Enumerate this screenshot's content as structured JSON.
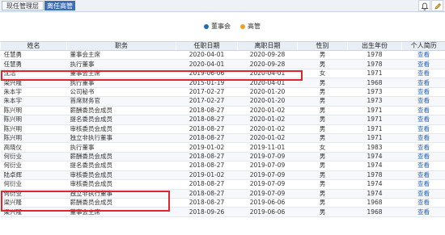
{
  "tabs": [
    {
      "label": "现任管理层"
    },
    {
      "label": "离任高管"
    }
  ],
  "toolbar": {
    "icons": [
      "bell-icon",
      "edit-icon"
    ]
  },
  "legend": [
    {
      "label": "董事会",
      "color": "#1f6db3"
    },
    {
      "label": "高管",
      "color": "#f0a11b"
    }
  ],
  "table": {
    "headers": [
      "姓名",
      "职务",
      "任职日期",
      "离职日期",
      "性别",
      "出生年份",
      "个人简历"
    ],
    "rows": [
      [
        "任慧勇",
        "董事会主席",
        "2020-04-01",
        "2020-09-28",
        "男",
        "1978",
        "查看"
      ],
      [
        "任慧勇",
        "执行董事",
        "2020-04-01",
        "2020-09-28",
        "男",
        "1978",
        "查看"
      ],
      [
        "沈洁",
        "董事会主席",
        "2019-06-06",
        "2020-04-01",
        "女",
        "1971",
        "查看"
      ],
      [
        "梁兴隆",
        "执行董事",
        "2015-01-19",
        "2020-04-01",
        "男",
        "1968",
        "查看"
      ],
      [
        "朱本宇",
        "公司秘书",
        "2017-02-27",
        "2020-01-20",
        "男",
        "1973",
        "查看"
      ],
      [
        "朱本宇",
        "首席财务官",
        "2017-02-27",
        "2020-01-20",
        "男",
        "1973",
        "查看"
      ],
      [
        "陈兴明",
        "薪酬委员会成员",
        "2018-08-27",
        "2020-01-02",
        "男",
        "1971",
        "查看"
      ],
      [
        "陈兴明",
        "提名委员会成员",
        "2018-08-27",
        "2020-01-02",
        "男",
        "1971",
        "查看"
      ],
      [
        "陈兴明",
        "审核委员会成员",
        "2018-08-27",
        "2020-01-02",
        "男",
        "1971",
        "查看"
      ],
      [
        "陈兴明",
        "独立非执行董事",
        "2018-08-27",
        "2020-01-02",
        "男",
        "1971",
        "查看"
      ],
      [
        "高晓仪",
        "执行董事",
        "2019-01-02",
        "2019-11-01",
        "女",
        "1983",
        "查看"
      ],
      [
        "何衍业",
        "薪酬委员会成员",
        "2018-08-27",
        "2019-07-09",
        "男",
        "1974",
        "查看"
      ],
      [
        "何衍业",
        "提名委员会成员",
        "2018-08-27",
        "2019-07-09",
        "男",
        "1974",
        "查看"
      ],
      [
        "陆卓辉",
        "审核委员会成员",
        "2019-01-02",
        "2019-07-09",
        "男",
        "1978",
        "查看"
      ],
      [
        "何衍业",
        "审核委员会成员",
        "2018-08-27",
        "2019-07-09",
        "男",
        "1974",
        "查看"
      ],
      [
        "何衍业",
        "独立非执行董事",
        "2018-08-27",
        "2019-07-09",
        "男",
        "1974",
        "查看"
      ],
      [
        "梁兴隆",
        "薪酬委员会成员",
        "2018-08-27",
        "2019-06-06",
        "男",
        "1968",
        "查看"
      ],
      [
        "梁兴隆",
        "董事会主席",
        "2018-09-26",
        "2019-06-06",
        "男",
        "1968",
        "查看"
      ]
    ]
  }
}
